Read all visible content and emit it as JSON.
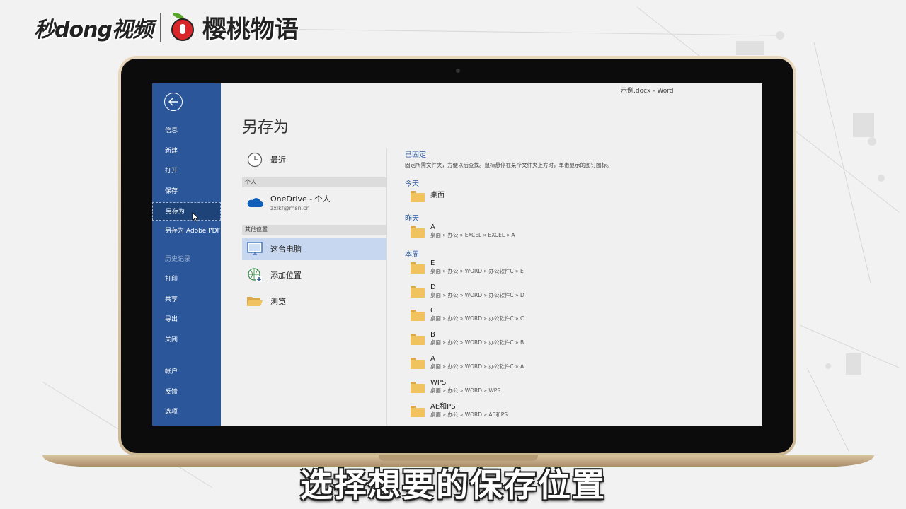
{
  "branding": {
    "left_logo": "秒dong视频",
    "right_logo": "樱桃物语"
  },
  "window": {
    "title": "示例.docx  -  Word"
  },
  "sidebar": {
    "items": [
      {
        "label": "信息"
      },
      {
        "label": "新建"
      },
      {
        "label": "打开"
      },
      {
        "label": "保存"
      },
      {
        "label": "另存为"
      },
      {
        "label": "另存为 Adobe PDF"
      },
      {
        "label": "历史记录"
      },
      {
        "label": "打印"
      },
      {
        "label": "共享"
      },
      {
        "label": "导出"
      },
      {
        "label": "关闭"
      },
      {
        "label": "帐户"
      },
      {
        "label": "反馈"
      },
      {
        "label": "选项"
      }
    ]
  },
  "main": {
    "title": "另存为",
    "recent_label": "最近",
    "personal_header": "个人",
    "onedrive": {
      "label": "OneDrive - 个人",
      "account": "zxlkf@msn.cn"
    },
    "other_header": "其他位置",
    "this_pc": "这台电脑",
    "add_place": "添加位置",
    "browse": "浏览"
  },
  "recent": {
    "pinned_title": "已固定",
    "pinned_desc": "固定所需文件夹，方便以后查找。鼠标悬停在某个文件夹上方时，单击显示的图钉图标。",
    "today_title": "今天",
    "today_folder": "桌面",
    "yesterday_title": "昨天",
    "yesterday_folder": {
      "name": "A",
      "path": "桌面 » 办公 » EXCEL » EXCEL » A"
    },
    "week_title": "本周",
    "week_folders": [
      {
        "name": "E",
        "path": "桌面 » 办公 » WORD » 办公软件C » E"
      },
      {
        "name": "D",
        "path": "桌面 » 办公 » WORD » 办公软件C » D"
      },
      {
        "name": "C",
        "path": "桌面 » 办公 » WORD » 办公软件C » C"
      },
      {
        "name": "B",
        "path": "桌面 » 办公 » WORD » 办公软件C » B"
      },
      {
        "name": "A",
        "path": "桌面 » 办公 » WORD » 办公软件C » A"
      },
      {
        "name": "WPS",
        "path": "桌面 » 办公 » WORD » WPS"
      },
      {
        "name": "AE和PS",
        "path": "桌面 » 办公 » WORD » AE和PS"
      }
    ]
  },
  "caption": "选择想要的保存位置",
  "colors": {
    "sidebar": "#2b579a",
    "selected": "#c6d7ef",
    "folder": "#f0c35e"
  }
}
